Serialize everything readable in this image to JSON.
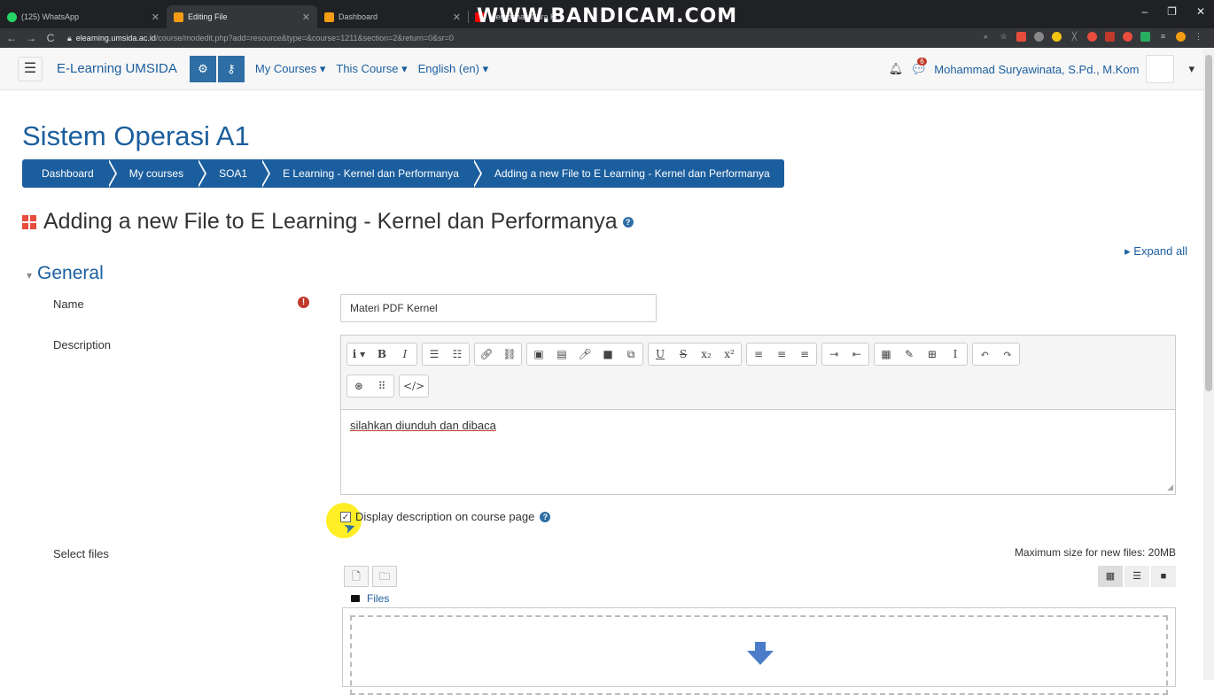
{
  "browser": {
    "tabs": [
      {
        "title": "(125) WhatsApp",
        "color": "#25d366"
      },
      {
        "title": "Editing File",
        "color": "#f39c12"
      },
      {
        "title": "Dashboard",
        "color": "#f39c12"
      },
      {
        "title": "Membahas Cara K...",
        "color": "#ff0000"
      }
    ],
    "url_host": "elearning.umsida.ac.id",
    "url_path": "/course/modedit.php?add=resource&type=&course=1211&section=2&return=0&sr=0",
    "watermark": "WWW.BANDICAM.COM"
  },
  "navbar": {
    "brand": "E-Learning UMSIDA",
    "menu": [
      "My Courses",
      "This Course",
      "English (en)"
    ],
    "notification_count": "6",
    "user_name": "Mohammad Suryawinata, S.Pd., M.Kom"
  },
  "page": {
    "course_title": "Sistem Operasi A1",
    "breadcrumb": [
      "Dashboard",
      "My courses",
      "SOA1",
      "E Learning - Kernel dan Performanya",
      "Adding a new File to E Learning - Kernel dan Performanya"
    ],
    "heading": "Adding a new File to E Learning - Kernel dan Performanya",
    "expand_all": "Expand all",
    "section_general": "General"
  },
  "form": {
    "name_label": "Name",
    "name_value": "Materi PDF Kernel",
    "description_label": "Description",
    "description_text": "silahkan diunduh dan dibaca",
    "display_description_label": "Display description on course page",
    "select_files_label": "Select files",
    "max_size": "Maximum size for new files: 20MB",
    "files_folder": "Files"
  },
  "colors": {
    "brand_blue": "#1b5e9e",
    "chrome_dark": "#202124",
    "required_red": "#c0392b"
  }
}
